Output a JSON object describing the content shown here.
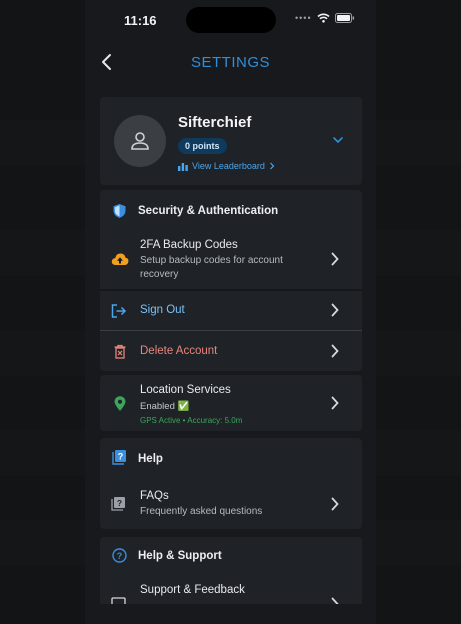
{
  "status": {
    "time": "11:16"
  },
  "nav": {
    "title": "SETTINGS"
  },
  "profile": {
    "username": "Sifterchief",
    "points": "0 points",
    "leaderboard_link": "View Leaderboard"
  },
  "security": {
    "header": "Security & Authentication",
    "backup": {
      "title": "2FA Backup Codes",
      "subtitle": "Setup backup codes for account recovery"
    },
    "sign_out": "Sign Out",
    "delete": "Delete Account"
  },
  "location": {
    "title": "Location Services",
    "status": "Enabled ✅",
    "gps": "GPS Active • Accuracy: 5.0m"
  },
  "help": {
    "header": "Help",
    "faqs": {
      "title": "FAQs",
      "subtitle": "Frequently asked questions"
    }
  },
  "support": {
    "header": "Help & Support",
    "feedback": {
      "title": "Support & Feedback"
    }
  },
  "colors": {
    "accent": "#2f8fd8",
    "danger": "#e8867d",
    "warning": "#f0a020",
    "success": "#3aa55b",
    "background": "#17191c",
    "card": "#1f2226"
  },
  "icons": [
    "back-chevron-icon",
    "user-icon",
    "bar-chart-icon",
    "chevron-right-icon",
    "chevron-down-icon",
    "shield-icon",
    "cloud-upload-icon",
    "sign-out-icon",
    "trash-icon",
    "location-pin-icon",
    "help-book-icon",
    "question-circle-icon",
    "chat-icon",
    "wifi-icon",
    "battery-icon"
  ]
}
